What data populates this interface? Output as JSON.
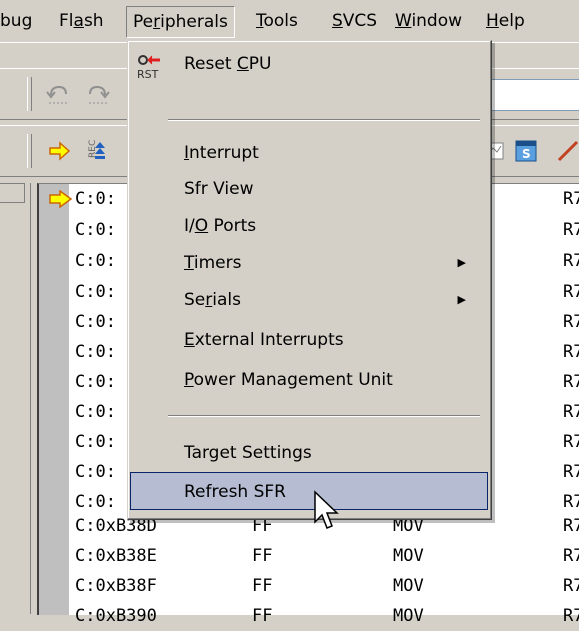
{
  "menubar": {
    "items": [
      {
        "label": "bug"
      },
      {
        "label": "Flash"
      },
      {
        "label": "Peripherals"
      },
      {
        "label": "Tools"
      },
      {
        "label": "SVCS"
      },
      {
        "label": "Window"
      },
      {
        "label": "Help"
      }
    ]
  },
  "peripherals_menu": {
    "items": [
      {
        "label": "Reset CPU",
        "icon": "rst-icon",
        "icon_text": "RST"
      },
      {
        "label": "Interrupt"
      },
      {
        "label": "Sfr View"
      },
      {
        "label": "I/O Ports"
      },
      {
        "label": "Timers",
        "submenu": true
      },
      {
        "label": "Serials",
        "submenu": true
      },
      {
        "label": "External Interrupts"
      },
      {
        "label": "Power Management Unit"
      },
      {
        "label": "Target Settings"
      },
      {
        "label": "Refresh SFR",
        "highlighted": true
      }
    ]
  },
  "disassembly": {
    "rows": [
      {
        "addr": "C:0:",
        "op": "",
        "mnemonic": "",
        "operand": "R7",
        "current": true
      },
      {
        "addr": "C:0:",
        "op": "",
        "mnemonic": "",
        "operand": "R7"
      },
      {
        "addr": "C:0:",
        "op": "",
        "mnemonic": "",
        "operand": "R7"
      },
      {
        "addr": "C:0:",
        "op": "",
        "mnemonic": "",
        "operand": "R7"
      },
      {
        "addr": "C:0:",
        "op": "",
        "mnemonic": "",
        "operand": "R7"
      },
      {
        "addr": "C:0:",
        "op": "",
        "mnemonic": "",
        "operand": "R7"
      },
      {
        "addr": "C:0:",
        "op": "",
        "mnemonic": "",
        "operand": "R7"
      },
      {
        "addr": "C:0:",
        "op": "",
        "mnemonic": "",
        "operand": "R7"
      },
      {
        "addr": "C:0:",
        "op": "",
        "mnemonic": "",
        "operand": "R7"
      },
      {
        "addr": "C:0:",
        "op": "",
        "mnemonic": "",
        "operand": "R7"
      },
      {
        "addr": "C:0:",
        "op": "",
        "mnemonic": "",
        "operand": "R7"
      },
      {
        "addr": "C:0xB38D",
        "op": "FF",
        "mnemonic": "MOV",
        "operand": "R7"
      },
      {
        "addr": "C:0xB38E",
        "op": "FF",
        "mnemonic": "MOV",
        "operand": "R7"
      },
      {
        "addr": "C:0xB38F",
        "op": "FF",
        "mnemonic": "MOV",
        "operand": "R7"
      },
      {
        "addr": "C:0xB390",
        "op": "FF",
        "mnemonic": "MOV",
        "operand": "R7"
      }
    ]
  },
  "colors": {
    "face": "#d4d0c8",
    "highlight": "#b6bdd2",
    "highlight_border": "#0a246a",
    "arrow_fill": "#ffff00",
    "arrow_stroke": "#cc6600"
  }
}
